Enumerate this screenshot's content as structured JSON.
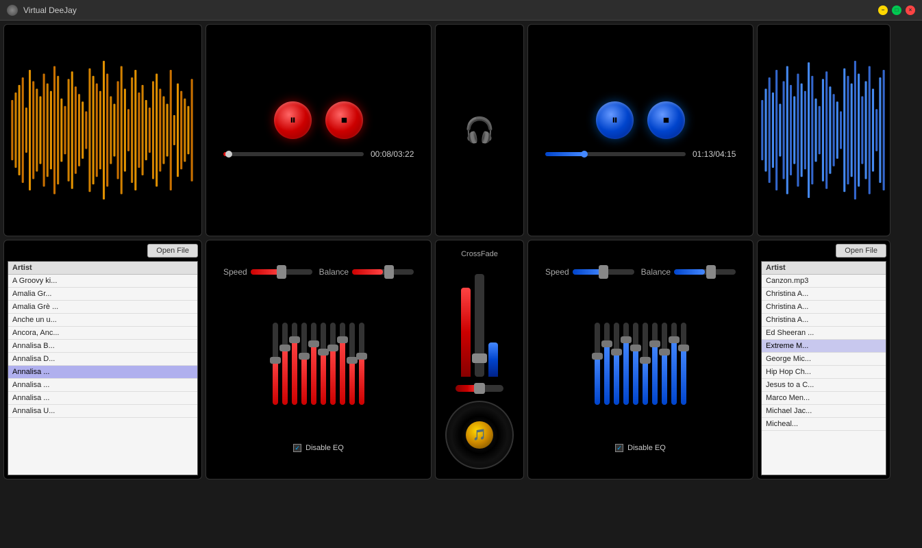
{
  "app": {
    "title": "Virtual DeeJay"
  },
  "title_bar": {
    "minimize_label": "−",
    "maximize_label": "□",
    "close_label": "×"
  },
  "deck_left": {
    "transport": {
      "pause_label": "⏸",
      "stop_label": "⏹",
      "time_display": "00:08/03:22",
      "progress_pct": 4
    },
    "speed_label": "Speed",
    "balance_label": "Balance",
    "eq": {
      "disable_label": "Disable EQ",
      "bars": [
        55,
        70,
        80,
        60,
        75,
        65,
        70,
        80,
        55,
        60
      ]
    }
  },
  "deck_right": {
    "transport": {
      "pause_label": "⏸",
      "stop_label": "⏹",
      "time_display": "01:13/04:15",
      "progress_pct": 28
    },
    "speed_label": "Speed",
    "balance_label": "Balance",
    "eq": {
      "disable_label": "Disable EQ",
      "bars": [
        60,
        75,
        65,
        80,
        70,
        55,
        75,
        65,
        80,
        70
      ]
    }
  },
  "crossfade": {
    "label": "CrossFade"
  },
  "file_list_left": {
    "open_file_label": "Open File",
    "artist_header": "Artist",
    "items": [
      "A Groovy ki...",
      "Amalia Gr...",
      "Amalia Grè ...",
      "Anche un u...",
      "Ancora, Anc...",
      "Annalisa  B...",
      "Annalisa  D...",
      "Annalisa  ...",
      "Annalisa  ...",
      "Annalisa  ...",
      "Annalisa  U..."
    ],
    "selected_index": 7
  },
  "file_list_right": {
    "open_file_label": "Open File",
    "artist_header": "Artist",
    "items": [
      "Canzon.mp3",
      "Christina A...",
      "Christina A...",
      "Christina A...",
      "Ed Sheeran ...",
      "Extreme  M...",
      "George Mic...",
      "Hip Hop Ch...",
      "Jesus to a C...",
      "Marco Men...",
      "Michael Jac...",
      "Micheal..."
    ],
    "selected_index": 5
  }
}
